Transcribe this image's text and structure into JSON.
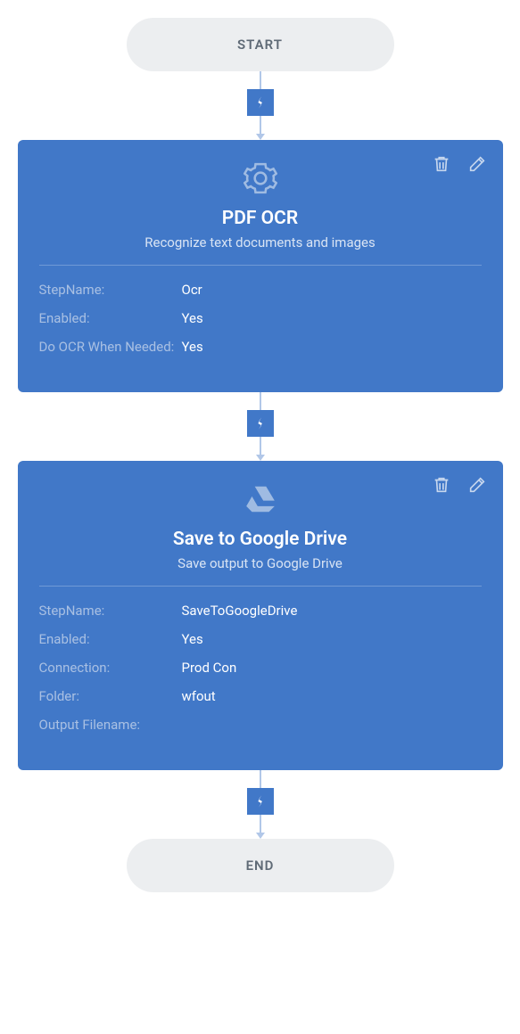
{
  "workflow": {
    "start_label": "START",
    "end_label": "END",
    "steps": [
      {
        "title": "PDF OCR",
        "subtitle": "Recognize text documents and images",
        "icon": "gear",
        "properties": [
          {
            "label": "StepName:",
            "value": "Ocr"
          },
          {
            "label": "Enabled:",
            "value": "Yes"
          },
          {
            "label": "Do OCR When Needed:",
            "value": "Yes"
          }
        ]
      },
      {
        "title": "Save to Google Drive",
        "subtitle": "Save output to Google Drive",
        "icon": "drive",
        "properties": [
          {
            "label": "StepName:",
            "value": "SaveToGoogleDrive"
          },
          {
            "label": "Enabled:",
            "value": "Yes"
          },
          {
            "label": "Connection:",
            "value": "Prod Con"
          },
          {
            "label": "Folder:",
            "value": "wfout"
          },
          {
            "label": "Output Filename:",
            "value": ""
          }
        ]
      }
    ]
  },
  "colors": {
    "card_bg": "#4178c8",
    "terminal_bg": "#eceef0",
    "terminal_text": "#5f6a76",
    "prop_label": "#a9c0e3"
  }
}
